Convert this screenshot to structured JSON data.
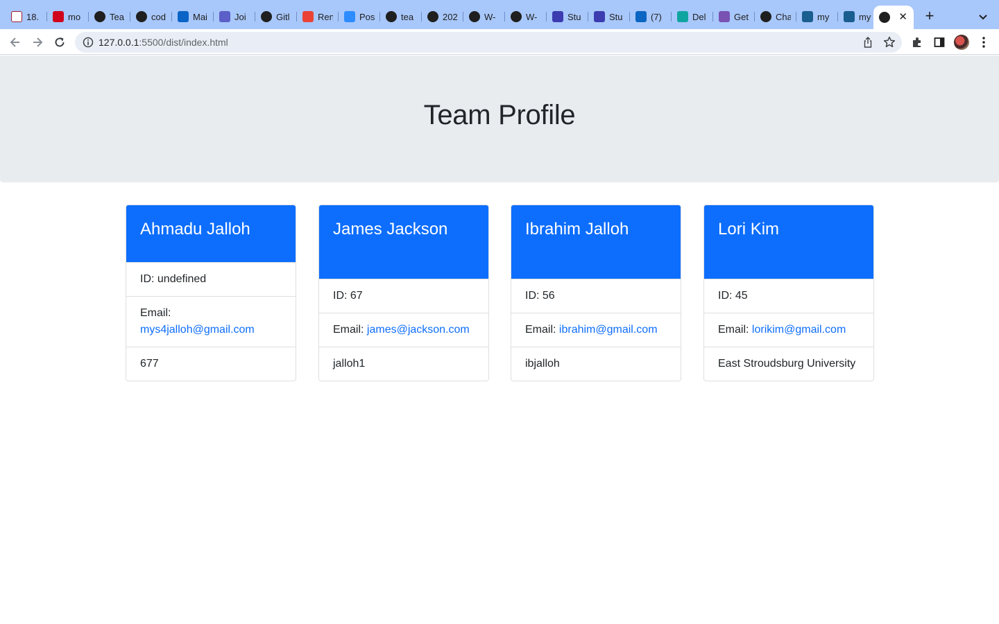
{
  "browser": {
    "tabs": [
      {
        "title": "18.",
        "icon": "university-shield-icon",
        "color": "#ffffff"
      },
      {
        "title": "mo",
        "icon": "red-square-icon",
        "color": "#d0021b"
      },
      {
        "title": "Tea",
        "icon": "github-icon",
        "color": "#1f1f1f"
      },
      {
        "title": "cod",
        "icon": "github-icon",
        "color": "#1f1f1f"
      },
      {
        "title": "Mai",
        "icon": "outlook-icon",
        "color": "#0a64c8"
      },
      {
        "title": "Joi",
        "icon": "teams-icon",
        "color": "#5b5fc7"
      },
      {
        "title": "Gitl",
        "icon": "github-icon",
        "color": "#1f1f1f"
      },
      {
        "title": "Ren",
        "icon": "gmail-icon",
        "color": "#ea4335"
      },
      {
        "title": "Pos",
        "icon": "zoom-icon",
        "color": "#2d8cff"
      },
      {
        "title": "tea",
        "icon": "github-icon",
        "color": "#1f1f1f"
      },
      {
        "title": "202",
        "icon": "globe-icon",
        "color": "#1f1f1f"
      },
      {
        "title": "W-",
        "icon": "globe-icon",
        "color": "#1f1f1f"
      },
      {
        "title": "W-",
        "icon": "globe-icon",
        "color": "#1f1f1f"
      },
      {
        "title": "Stu",
        "icon": "layout-icon",
        "color": "#3c3cb0"
      },
      {
        "title": "Stu",
        "icon": "layout-icon",
        "color": "#3c3cb0"
      },
      {
        "title": "(7)",
        "icon": "linkedin-icon",
        "color": "#0a66c2"
      },
      {
        "title": "Del",
        "icon": "diamond-icon",
        "color": "#0ea5a0"
      },
      {
        "title": "Get",
        "icon": "bootstrap-icon",
        "color": "#7952b3"
      },
      {
        "title": "Cha",
        "icon": "github-icon",
        "color": "#1f1f1f"
      },
      {
        "title": "my",
        "icon": "app-icon",
        "color": "#1a5d8f"
      },
      {
        "title": "my",
        "icon": "app-icon",
        "color": "#1a5d8f"
      },
      {
        "title": "",
        "icon": "globe-icon",
        "color": "#1f1f1f",
        "active": true
      }
    ],
    "close_tab": "✕",
    "new_tab": "+",
    "url_host": "127.0.0.1",
    "url_rest": ":5500/dist/index.html"
  },
  "page": {
    "title": "Team Profile",
    "cards": [
      {
        "name": "Ahmadu Jalloh",
        "id_label": "ID: undefined",
        "email_label": "Email:",
        "email": "mys4jalloh@gmail.com",
        "extra": "677"
      },
      {
        "name": "James Jackson",
        "id_label": "ID: 67",
        "email_label": "Email:",
        "email": "james@jackson.com",
        "extra": "jalloh1"
      },
      {
        "name": "Ibrahim Jalloh",
        "id_label": "ID: 56",
        "email_label": "Email:",
        "email": "ibrahim@gmail.com",
        "extra": "ibjalloh"
      },
      {
        "name": "Lori Kim",
        "id_label": "ID: 45",
        "email_label": "Email:",
        "email": "lorikim@gmail.com",
        "extra": "East Stroudsburg University"
      }
    ]
  }
}
